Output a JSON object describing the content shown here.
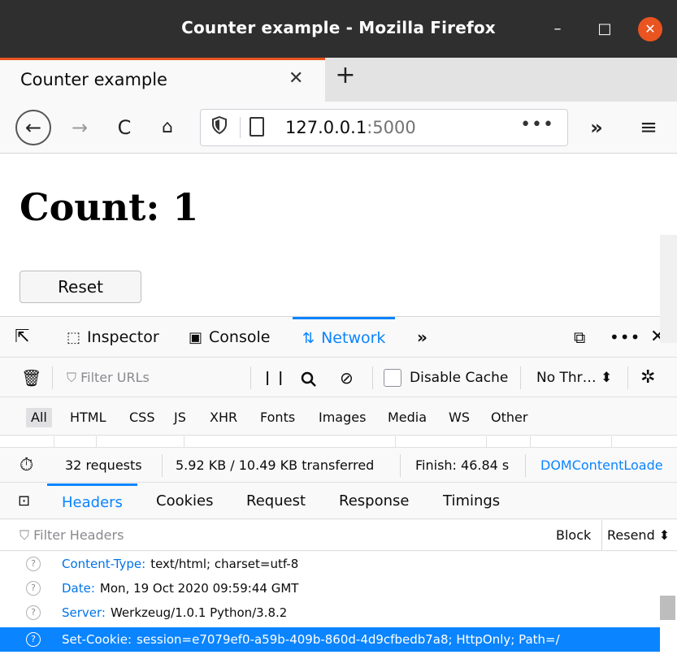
{
  "window": {
    "title": "Counter example - Mozilla Firefox",
    "controls": {
      "minimize": "–",
      "maximize": "□",
      "close": "✕"
    }
  },
  "tabs": [
    {
      "label": "Counter example",
      "close": "✕"
    }
  ],
  "newtab": "+",
  "nav": {
    "back": "←",
    "forward": "→",
    "reload": "C",
    "home": "⌂",
    "url_host": "127.0.0.1",
    "url_port": ":5000",
    "page_actions": "•••",
    "overflow": "»",
    "menu": "≡"
  },
  "page": {
    "heading": "Count: 1",
    "reset_button": "Reset"
  },
  "devtools": {
    "tabs": {
      "picker": "⇱",
      "inspector": "Inspector",
      "console": "Console",
      "network": "Network",
      "more": "»",
      "dock": "⧉",
      "options": "•••",
      "close": "✕"
    },
    "toolbar": {
      "trash": "🗑",
      "filter_placeholder": "Filter URLs",
      "pause": "| |",
      "search": "🔍",
      "block": "⊘",
      "disable_cache": "Disable Cache",
      "throttle": "No Thr… ⬍",
      "settings": "✲"
    },
    "types": [
      "All",
      "HTML",
      "CSS",
      "JS",
      "XHR",
      "Fonts",
      "Images",
      "Media",
      "WS",
      "Other"
    ],
    "status": {
      "requests": "32 requests",
      "transferred": "5.92 KB / 10.49 KB transferred",
      "finish": "Finish: 46.84 s",
      "domcontent": "DOMContentLoade"
    },
    "detail_tabs": [
      "Headers",
      "Cookies",
      "Request",
      "Response",
      "Timings"
    ],
    "headers_filter_placeholder": "Filter Headers",
    "block_label": "Block",
    "resend_label": "Resend ⬍",
    "headers": [
      {
        "name": "Content-Type:",
        "value": "text/html; charset=utf-8"
      },
      {
        "name": "Date:",
        "value": "Mon, 19 Oct 2020 09:59:44 GMT"
      },
      {
        "name": "Server:",
        "value": "Werkzeug/1.0.1 Python/3.8.2"
      },
      {
        "name": "Set-Cookie:",
        "value": "session=e7079ef0-a59b-409b-860d-4d9cfbedb7a8; HttpOnly; Path=/"
      }
    ]
  }
}
